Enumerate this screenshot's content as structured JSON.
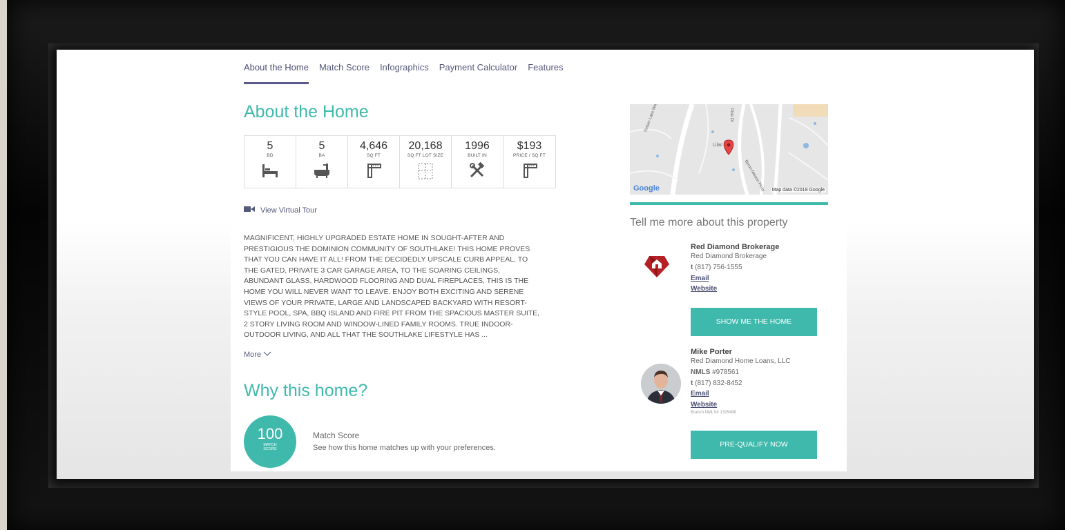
{
  "tabs": [
    "About the Home",
    "Match Score",
    "Infographics",
    "Payment Calculator",
    "Features"
  ],
  "about": {
    "title": "About the Home",
    "stats": [
      {
        "value": "5",
        "label": "BD",
        "icon": "bed-icon"
      },
      {
        "value": "5",
        "label": "BA",
        "icon": "bathtub-icon"
      },
      {
        "value": "4,646",
        "label": "SQ FT",
        "icon": "ruler-icon"
      },
      {
        "value": "20,168",
        "label": "SQ FT LOT SIZE",
        "icon": "lot-size-icon"
      },
      {
        "value": "1996",
        "label": "BUILT IN",
        "icon": "tools-icon"
      },
      {
        "value": "$193",
        "label": "PRICE / SQ FT",
        "icon": "ruler-icon"
      }
    ],
    "virtual_tour": "View Virtual Tour",
    "description_lines": [
      "MAGNIFICENT, HIGHLY UPGRADED ESTATE HOME IN SOUGHT-AFTER AND",
      "PRESTIGIOUS THE DOMINION COMMUNITY OF SOUTHLAKE! THIS HOME PROVES",
      "THAT YOU CAN HAVE IT ALL! FROM THE DECIDEDLY UPSCALE CURB APPEAL, TO",
      "THE GATED, PRIVATE 3 CAR GARAGE AREA, TO THE SOARING CEILINGS,",
      "ABUNDANT GLASS, HARDWOOD FLOORING AND DUAL FIREPLACES, THIS IS THE",
      "HOME YOU WILL NEVER WANT TO LEAVE. ENJOY BOTH EXCITING AND SERENE",
      "VIEWS OF YOUR PRIVATE, LARGE AND LANDSCAPED BACKYARD WITH RESORT-",
      "STYLE POOL, SPA, BBQ ISLAND AND FIRE PIT FROM THE SPACIOUS MASTER SUITE,",
      "2 STORY LIVING ROOM AND WINDOW-LINED FAMILY ROOMS. TRUE INDOOR-",
      "OUTDOOR LIVING, AND ALL THAT THE SOUTHLAKE LIFESTYLE HAS ..."
    ],
    "more": "More"
  },
  "why": {
    "title": "Why this home?",
    "score": "100",
    "score_label_1": "MATCH",
    "score_label_2": "SCORE",
    "match_title": "Match Score",
    "match_sub": "See how this home matches up with your preferences."
  },
  "map": {
    "google": "Google",
    "attribution": "Map data ©2018 Google",
    "street_1": "Pine Dr",
    "street_2": "Lilac",
    "street_3": "Byron Nelson Pkwy",
    "street_4": "Timber Lake Way"
  },
  "contact": {
    "heading": "Tell me more about this property",
    "agent1": {
      "name": "Red Diamond Brokerage",
      "company": "Red Diamond Brokerage",
      "phone_prefix": "t",
      "phone": "(817) 756-1555",
      "email": "Email",
      "website": "Website",
      "cta": "SHOW ME THE HOME"
    },
    "agent2": {
      "name": "Mike Porter",
      "company": "Red Diamond Home Loans, LLC",
      "nmls_prefix": "NMLS",
      "nmls": "#978561",
      "phone_prefix": "t",
      "phone": "(817) 832-8452",
      "email": "Email",
      "website": "Website",
      "branch": "Branch NMLS# 1325498",
      "cta": "PRE-QUALIFY NOW"
    }
  },
  "colors": {
    "accent": "#40b9ad",
    "nav": "#555a7a",
    "brand_red": "#b52025"
  }
}
